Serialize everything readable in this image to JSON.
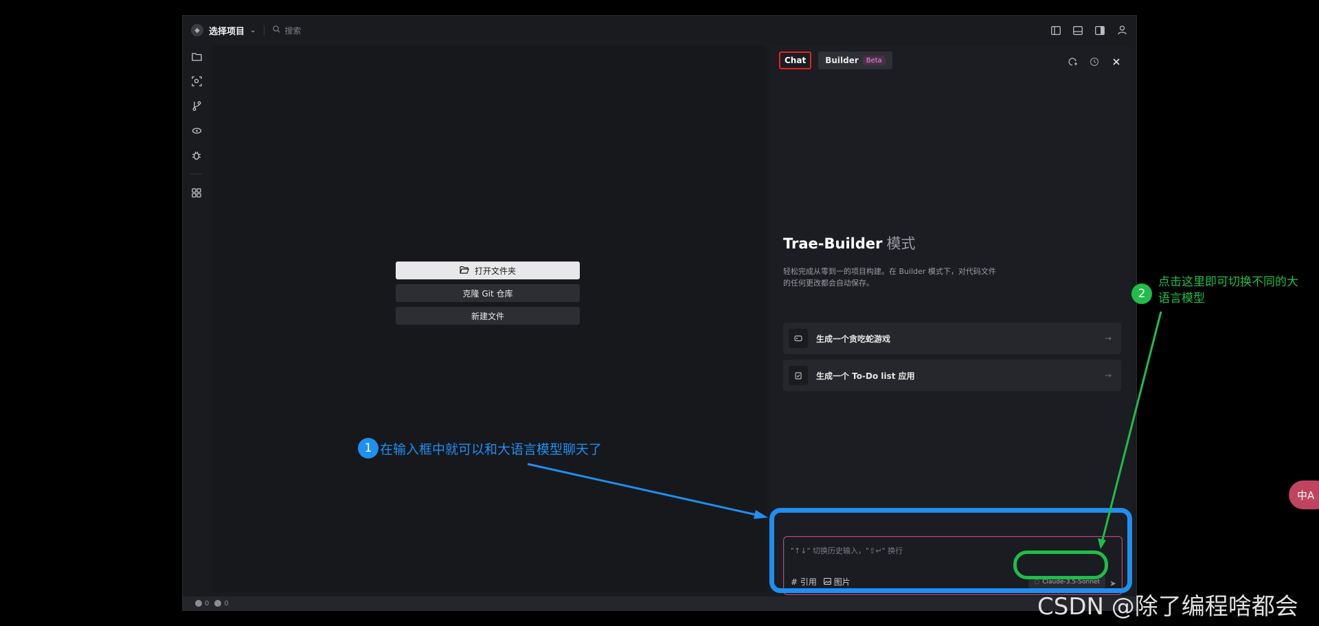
{
  "topbar": {
    "project_label": "选择项目",
    "search_placeholder": "搜索"
  },
  "editor": {
    "open_folder": "打开文件夹",
    "clone_repo": "克隆 Git 仓库",
    "new_file": "新建文件"
  },
  "chat": {
    "tab_chat": "Chat",
    "tab_builder": "Builder",
    "beta_badge": "Beta",
    "intro_title": "Trae-Builder",
    "intro_mode": "模式",
    "intro_desc": "轻松完成从零到一的项目构建。在 Builder 模式下，对代码文件的任何更改都会自动保存。",
    "suggestions": [
      {
        "label": "生成一个贪吃蛇游戏",
        "icon": "gamepad-icon"
      },
      {
        "label": "生成一个 To-Do list 应用",
        "icon": "checklist-icon"
      }
    ],
    "input_placeholder": "\"↑↓\" 切换历史输入，\"⇧↵\" 换行",
    "ref_label": "引用",
    "image_label": "图片",
    "model": "Claude-3.5-Sonnet"
  },
  "statusbar": {
    "errors": "0",
    "warnings": "0"
  },
  "annotations": {
    "badge1": "1",
    "text1": "在输入框中就可以和大语言模型聊天了",
    "badge2": "2",
    "text2": "点击这里即可切换不同的大语言模型",
    "blue": "#1f8ff0",
    "green": "#1fbd4a"
  },
  "fab_label": "中A",
  "watermark": "CSDN @除了编程啥都会"
}
